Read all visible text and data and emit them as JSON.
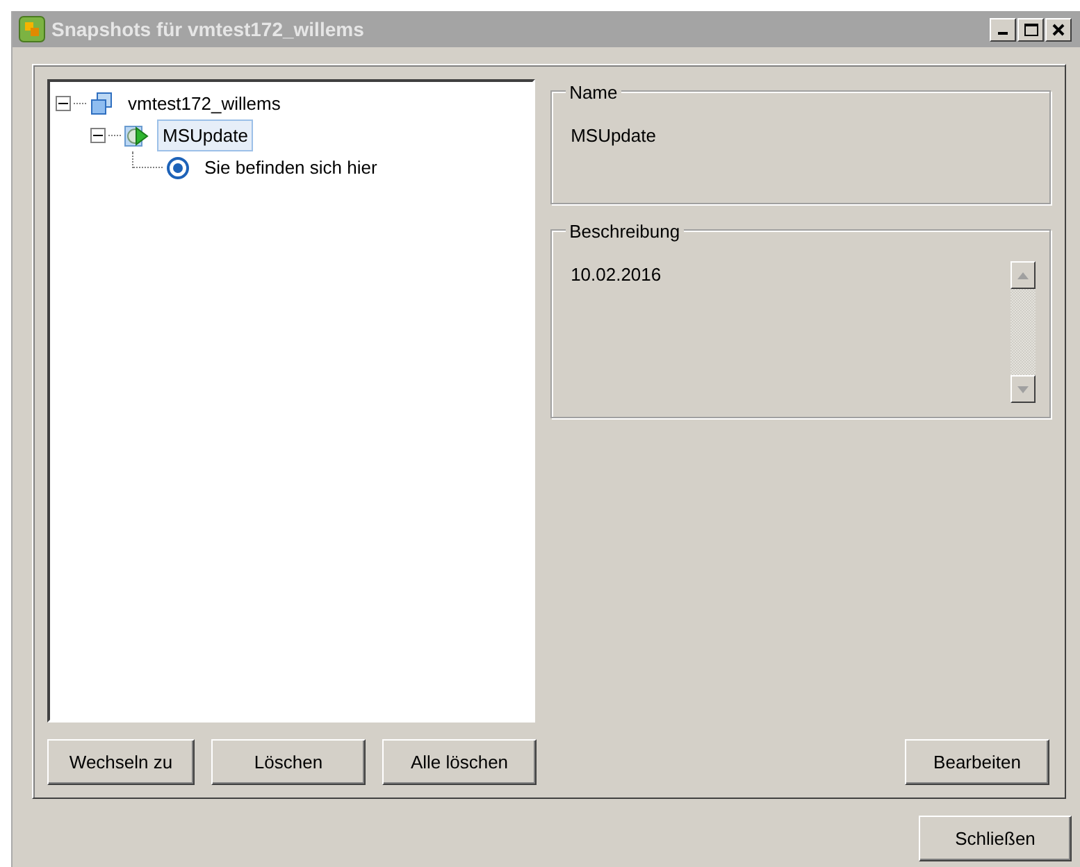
{
  "window": {
    "title": "Snapshots für vmtest172_willems"
  },
  "tree": [
    {
      "label": "vmtest172_willems",
      "kind": "vm",
      "expanded": true,
      "selected": false,
      "children": [
        {
          "label": "MSUpdate",
          "kind": "snapshot",
          "expanded": true,
          "selected": true,
          "children": [
            {
              "label": "Sie befinden sich hier",
              "kind": "current",
              "selected": false
            }
          ]
        }
      ]
    }
  ],
  "name_group": {
    "legend": "Name",
    "value": "MSUpdate"
  },
  "description_group": {
    "legend": "Beschreibung",
    "value": "10.02.2016"
  },
  "tree_buttons": [
    "Wechseln zu",
    "Löschen",
    "Alle löschen"
  ],
  "edit_button": "Bearbeiten",
  "close_button": "Schließen"
}
